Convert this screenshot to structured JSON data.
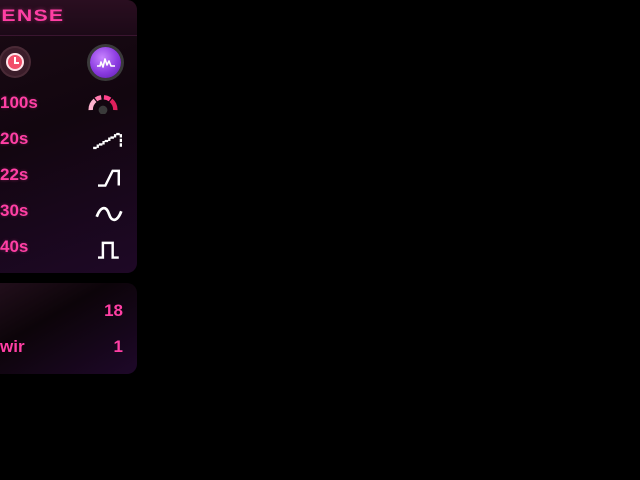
{
  "header": {
    "brand_text": "VENSE"
  },
  "columns": {
    "left_icon": "clock-icon",
    "right_icon": "waveform-icon"
  },
  "rows": [
    {
      "value": "100s",
      "icon": "gauge-icon"
    },
    {
      "value": "20s",
      "icon": "staircase-icon"
    },
    {
      "value": "22s",
      "icon": "ramp-step-icon"
    },
    {
      "value": "30s",
      "icon": "sine-wave-icon"
    },
    {
      "value": "40s",
      "icon": "square-pulse-icon"
    }
  ],
  "stats": [
    {
      "label": "",
      "value": "18"
    },
    {
      "label": "wir",
      "value": "1"
    }
  ],
  "colors": {
    "accent": "#ff3fa4",
    "background": "#000000",
    "panel": "#16070f",
    "purple": "#8a3ae0"
  }
}
